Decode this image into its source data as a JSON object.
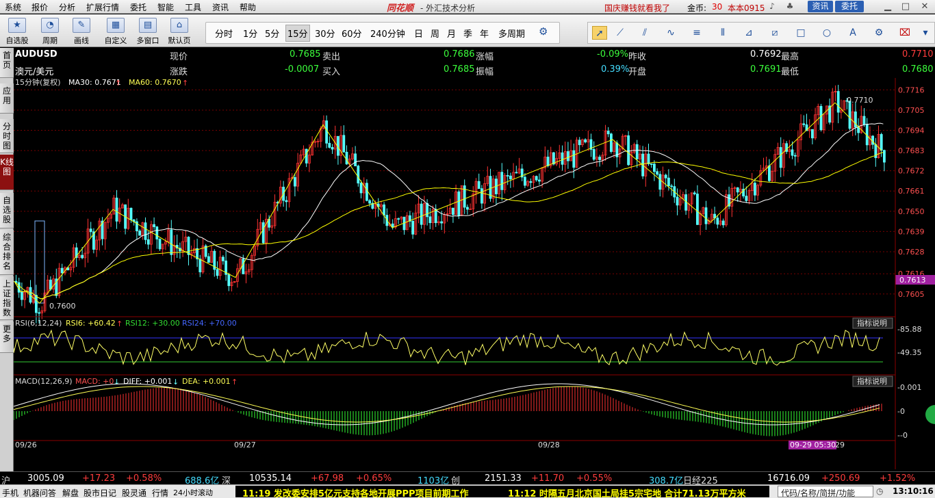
{
  "menu": {
    "items": [
      "系统",
      "报价",
      "分析",
      "扩展行情",
      "委托",
      "智能",
      "工具",
      "资讯",
      "帮助"
    ],
    "logo": "同花顺",
    "window_title": "- 外汇技术分析",
    "promo": "国庆赚钱就看我了",
    "coin_label": "金币:",
    "coin_value": "30",
    "account": "本本0915",
    "info_button": "资讯",
    "trade_button": "委托"
  },
  "toolbar": {
    "buttons": [
      {
        "label": "自选股",
        "icon": "star-icon"
      },
      {
        "label": "周期",
        "icon": "clock-icon"
      },
      {
        "label": "画线",
        "icon": "pen-icon"
      },
      {
        "label": "自定义",
        "icon": "grid-icon"
      },
      {
        "label": "多窗口",
        "icon": "windows-icon"
      },
      {
        "label": "默认页",
        "icon": "home-icon"
      }
    ],
    "periods": [
      "分时",
      "1分",
      "5分",
      "15分",
      "30分",
      "60分",
      "240分钟",
      "日",
      "周",
      "月",
      "季",
      "年",
      "多周期"
    ],
    "active_period": "15分"
  },
  "sidetabs": [
    {
      "label": "首页",
      "active": false
    },
    {
      "label": "应用",
      "active": false
    },
    {
      "label": "分时图",
      "active": false
    },
    {
      "label": "K线图",
      "active": true
    },
    {
      "label": "自选股",
      "active": false
    },
    {
      "label": "综合排名",
      "active": false
    },
    {
      "label": "上证指数",
      "active": false
    },
    {
      "label": "更多",
      "active": false
    }
  ],
  "quote": {
    "symbol": "AUDUSD",
    "name": "澳元/美元",
    "now_label": "现价",
    "now": "0.7685",
    "change_label": "涨跌",
    "change": "-0.0007",
    "sell_label": "卖出",
    "sell": "0.7686",
    "buy_label": "买入",
    "buy": "0.7685",
    "pct_label": "涨幅",
    "pct": "-0.09%",
    "amp_label": "振幅",
    "amp": "0.39%",
    "prev_label": "昨收",
    "prev": "0.7692",
    "open_label": "开盘",
    "open": "0.7691",
    "high_label": "最高",
    "high": "0.7710",
    "low_label": "最低",
    "low": "0.7680"
  },
  "indicators": {
    "main_header": "15分钟(复权)",
    "ma30": "MA30: 0.7671",
    "ma60": "MA60: 0.7670",
    "rsi_name": "RSI(6,12,24)",
    "rsi6": "RSI6: +60.42",
    "rsi12": "RSI12: +30.00",
    "rsi24": "RSI24: +70.00",
    "macd_name": "MACD(12,26,9)",
    "macd": "MACD: +0",
    "diff": "DIFF: +0.001",
    "dea": "DEA: +0.001",
    "explain_btn": "指标说明"
  },
  "chart_data": {
    "type": "candlestick",
    "ylim": [
      0.7596,
      0.7718
    ],
    "y_ticks": [
      "0.7716",
      "0.7705",
      "0.7694",
      "0.7683",
      "0.7672",
      "0.7661",
      "0.7650",
      "0.7639",
      "0.7628",
      "0.7616",
      "0.7605"
    ],
    "current_price_tag": "0.7613",
    "high_annotation": "0.7710",
    "low_annotation": "0.7600",
    "x_labels": [
      "09/26",
      "09/27",
      "09/28",
      "09-29 05:30",
      "29"
    ],
    "rsi_ticks": [
      "85.88",
      "49.35"
    ],
    "macd_ticks": [
      "0.001",
      "0",
      "-0"
    ],
    "colors": {
      "up": "#ff3232",
      "down": "#54ffff",
      "ma30": "#ffffff",
      "ma60": "#ffff00",
      "zigzag": "#ffff00",
      "grid": "#7a0000",
      "macd_up": "#ff3232",
      "macd_down": "#33ff33"
    },
    "zigzag": [
      0.7612,
      0.76,
      0.7651,
      0.763,
      0.7614,
      0.7697,
      0.7641,
      0.7689,
      0.7644,
      0.7709,
      0.7683
    ]
  },
  "index_bar": [
    {
      "name": "沪",
      "value": "3005.09",
      "change": "+17.23",
      "pct": "+0.58%",
      "vol": "688.6亿"
    },
    {
      "name": "深",
      "value": "10535.14",
      "change": "+67.98",
      "pct": "+0.65%",
      "vol": "1103亿"
    },
    {
      "name": "创",
      "value": "2151.33",
      "change": "+11.70",
      "pct": "+0.55%",
      "vol": "308.7亿"
    },
    {
      "name": "日经225",
      "value": "16716.09",
      "change": "+250.69",
      "pct": "+1.52%"
    }
  ],
  "statusbar": {
    "items": [
      "手机",
      "机器问答",
      "解盘",
      "股市日记",
      "股灵通",
      "行情",
      "24小时滚动"
    ],
    "news1": "11:19 发改委安排5亿元支持各地开展PPP项目前期工作",
    "news2": "11:12 时隔五月北京国土局挂5宗宅地 合计71.13万平方米",
    "search_placeholder": "代码/名称/简拼/功能",
    "clock": "13:10:16"
  }
}
